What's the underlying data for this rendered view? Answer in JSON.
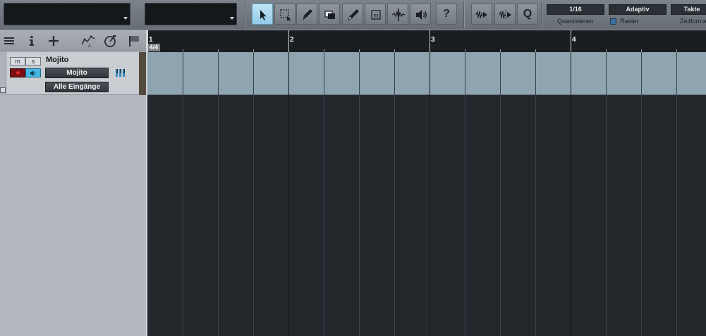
{
  "toolbar": {
    "quantize_value": "1/16",
    "quantize_label": "Quantisieren",
    "snap_value": "Adaptiv",
    "snap_label": "Raster",
    "timebase_value": "Takte",
    "timebase_label": "Zeitformat",
    "help_glyph": "?",
    "quantize_glyph": "Q",
    "active_tool": "arrow-tool",
    "tools": [
      "arrow-tool-icon",
      "range-tool-icon",
      "split-tool-icon",
      "eraser-tool-icon",
      "paint-tool-icon",
      "mute-tool-icon",
      "bend-tool-icon",
      "listen-tool-icon"
    ],
    "colors": {
      "toolbar": "#6f767e",
      "active_tool": "#a6d6ef"
    }
  },
  "ruler": {
    "time_signature": "4/4",
    "bars": [
      "1",
      "2",
      "3",
      "4"
    ]
  },
  "tracks": [
    {
      "name": "Mojito",
      "mute_label": "m",
      "solo_label": "s",
      "instrument_label": "Mojito",
      "input_label": "Alle Eingänge",
      "record_armed": true,
      "monitor_on": true,
      "colors": {
        "lane": "#8ea4b0",
        "record": "#7a0f12",
        "monitor": "#43b6e2"
      }
    }
  ],
  "colors": {
    "arrange_bg": "#23282d",
    "ruler_bg": "#1b1e21",
    "tracklist_bg": "#b3b8be"
  }
}
